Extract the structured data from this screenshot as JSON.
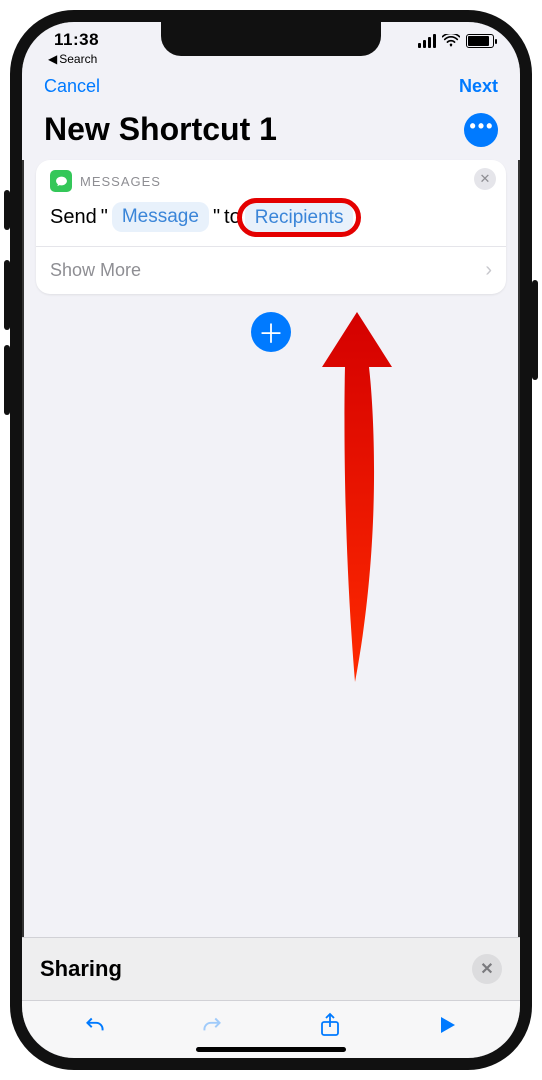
{
  "status": {
    "time": "11:38",
    "back_label": "Search"
  },
  "nav": {
    "cancel": "Cancel",
    "next": "Next"
  },
  "title": "New Shortcut 1",
  "action_card": {
    "app_name": "MESSAGES",
    "prefix": "Send",
    "quote_open": "\"",
    "message_token": "Message",
    "quote_close": "\"",
    "to_word": "to",
    "recipients_token": "Recipients",
    "show_more": "Show More"
  },
  "sharing": {
    "title": "Sharing"
  }
}
